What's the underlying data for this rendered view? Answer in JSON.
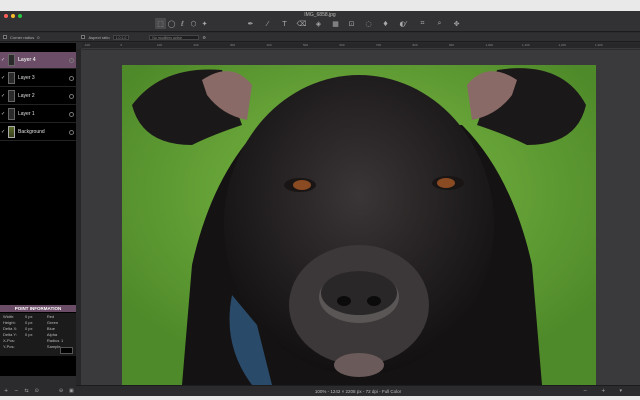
{
  "window": {
    "title": "IMG_6858.jpg"
  },
  "toolbar": {
    "tools": [
      {
        "icon": "rect-select-icon",
        "glyph": "⬚",
        "selected": true
      },
      {
        "icon": "ellipse-select-icon",
        "glyph": "◯",
        "selected": false
      },
      {
        "icon": "lasso-icon",
        "glyph": "ℓ",
        "selected": false
      },
      {
        "icon": "poly-lasso-icon",
        "glyph": "⬡",
        "selected": false
      },
      {
        "icon": "magic-wand-icon",
        "glyph": "✦",
        "selected": false
      }
    ],
    "tools2": [
      {
        "icon": "pen-icon",
        "glyph": "✒"
      },
      {
        "icon": "brush-icon",
        "glyph": "⁄"
      },
      {
        "icon": "text-tool-icon",
        "glyph": "T"
      },
      {
        "icon": "eraser-icon",
        "glyph": "⌫"
      },
      {
        "icon": "fill-icon",
        "glyph": "◈"
      },
      {
        "icon": "gradient-icon",
        "glyph": "▦"
      }
    ],
    "tools3": [
      {
        "icon": "stamp-icon",
        "glyph": "⊡"
      },
      {
        "icon": "blur-icon",
        "glyph": "◌"
      },
      {
        "icon": "drop-icon",
        "glyph": "♦"
      },
      {
        "icon": "dodge-icon",
        "glyph": "◐"
      }
    ],
    "tools4": [
      {
        "icon": "eyedropper-icon",
        "glyph": "⁄"
      },
      {
        "icon": "crop-icon",
        "glyph": "⌗"
      },
      {
        "icon": "zoom-icon",
        "glyph": "⌕"
      },
      {
        "icon": "move-icon",
        "glyph": "✥"
      }
    ]
  },
  "options": {
    "corner_radius_label": "Corner radius",
    "corner_radius_value": "0",
    "aspect_ratio_label": "Aspect ratio",
    "aspect_ratio_value": "1.0:1.0",
    "no_modifiers": "No modifiers active"
  },
  "layers": [
    {
      "name": "Layer 4",
      "selected": true
    },
    {
      "name": "Layer 3",
      "selected": false
    },
    {
      "name": "Layer 2",
      "selected": false
    },
    {
      "name": "Layer 1",
      "selected": false
    },
    {
      "name": "Background",
      "selected": false
    }
  ],
  "point_info": {
    "title": "POINT INFORMATION",
    "rows": [
      {
        "k": "Width:",
        "v": "0 px",
        "k2": "Red",
        "v2": ""
      },
      {
        "k": "Height:",
        "v": "0 px",
        "k2": "Green",
        "v2": ""
      },
      {
        "k": "Delta X:",
        "v": "0 px",
        "k2": "Blue",
        "v2": ""
      },
      {
        "k": "Delta Y:",
        "v": "0 px",
        "k2": "Alpha",
        "v2": ""
      },
      {
        "k": "X-Pos:",
        "v": "",
        "k2": "Radius",
        "v2": "1"
      },
      {
        "k": "Y-Pos:",
        "v": "",
        "k2": "Sample",
        "v2": ""
      }
    ]
  },
  "ruler": {
    "ticks": [
      "-100",
      "0",
      "100",
      "200",
      "300",
      "400",
      "500",
      "600",
      "700",
      "800",
      "900",
      "1,000",
      "1,100",
      "1,200",
      "1,300"
    ]
  },
  "status": {
    "info": "100% - 1242 × 2208 px - 72 dpi - Full Color",
    "zoom_out": "−",
    "zoom_in": "+",
    "fit": "▾"
  },
  "colors": {
    "accent": "#6b4d67",
    "grass": "#66a336",
    "dog": "#1d1a1b"
  }
}
